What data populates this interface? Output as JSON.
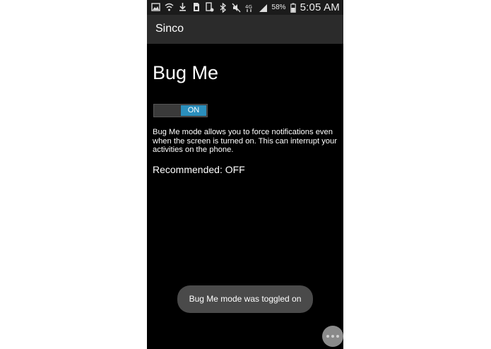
{
  "status_bar": {
    "icons": [
      "gallery-icon",
      "wifi-icon",
      "download-icon",
      "sim-icon",
      "device-icon",
      "bluetooth-icon",
      "mute-icon",
      "signal-4g-icon",
      "signal-bars-icon",
      "battery-icon"
    ],
    "battery_percent": "58%",
    "time": "5:05 AM"
  },
  "action_bar": {
    "title": "Sinco"
  },
  "content": {
    "title": "Bug Me",
    "toggle": {
      "label": "ON",
      "state": "on",
      "accent": "#2b8fbd"
    },
    "description": "Bug Me mode allows you to force notifications even when the screen is turned on. This can interrupt your activities on the phone.",
    "recommended": "Recommended: OFF"
  },
  "toast": {
    "message": "Bug Me mode was toggled on"
  },
  "overflow_button": {
    "icon": "more-icon"
  }
}
